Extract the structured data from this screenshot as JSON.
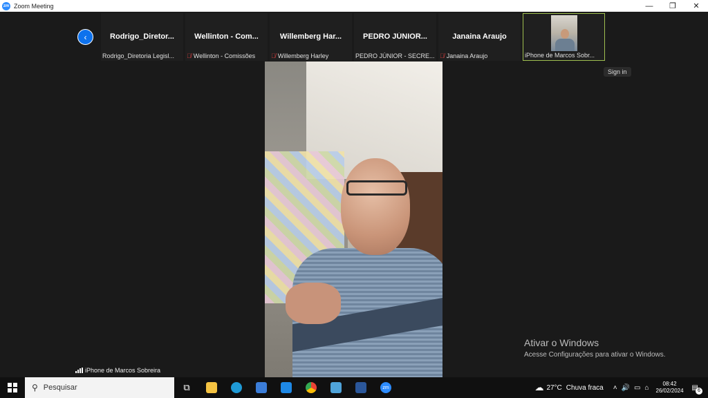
{
  "window": {
    "app_icon": "zm",
    "title": "Zoom Meeting",
    "minimize": "—",
    "restore": "❐",
    "close": "✕"
  },
  "participants_strip": [
    {
      "title": "Rodrigo_Diretor...",
      "label": "Rodrigo_Diretoria Legisl...",
      "muted": false
    },
    {
      "title": "Wellinton - Com...",
      "label": "Wellinton - Comissões",
      "muted": true
    },
    {
      "title": "Willemberg Har...",
      "label": "Willemberg Harley",
      "muted": true
    },
    {
      "title": "PEDRO JÚNIOR...",
      "label": "PEDRO JÚNIOR - SECRE...",
      "muted": false
    },
    {
      "title": "Janaina Araujo",
      "label": "Janaina Araujo",
      "muted": true
    }
  ],
  "active_tile": {
    "label": "iPhone de Marcos Sobr..."
  },
  "signin_tooltip": "Sign in",
  "speaker": {
    "name": "iPhone de Marcos Sobreira"
  },
  "watermark": {
    "line1": "Ativar o Windows",
    "line2": "Acesse Configurações para ativar o Windows."
  },
  "taskbar": {
    "search_placeholder": "Pesquisar",
    "zoom_icon_text": "zm",
    "weather_temp": "27°C",
    "weather_text": "Chuva fraca",
    "time": "08:42",
    "date": "26/02/2024",
    "notifications": "6"
  },
  "colors": {
    "zoom_blue": "#0e72ed",
    "active_border": "#a0c050",
    "mute_red": "#e04040"
  }
}
